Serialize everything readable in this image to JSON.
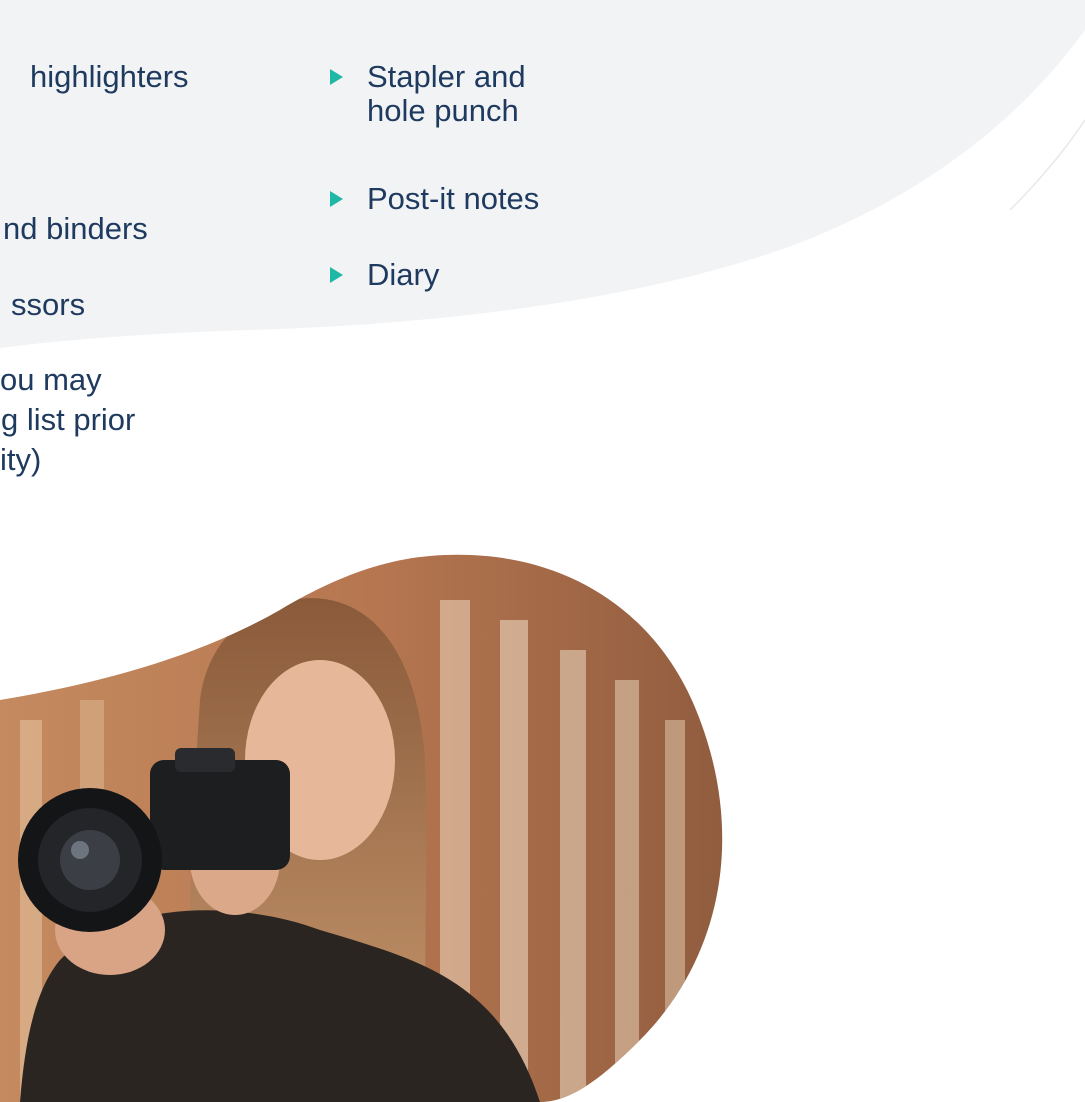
{
  "left_column": {
    "items": [
      "highlighters",
      "nd binders",
      "ssors"
    ],
    "note_lines": [
      "ou may",
      "g list prior",
      "ity)"
    ]
  },
  "right_column": {
    "items": [
      {
        "lines": [
          "Stapler and",
          "hole punch"
        ]
      },
      {
        "lines": [
          "Post-it notes"
        ]
      },
      {
        "lines": [
          "Diary"
        ]
      }
    ]
  },
  "colors": {
    "text": "#1f3a5f",
    "bullet": "#1fb8a6",
    "background_wave": "#f2f3f5"
  },
  "photo": {
    "subject": "woman-with-camera"
  }
}
